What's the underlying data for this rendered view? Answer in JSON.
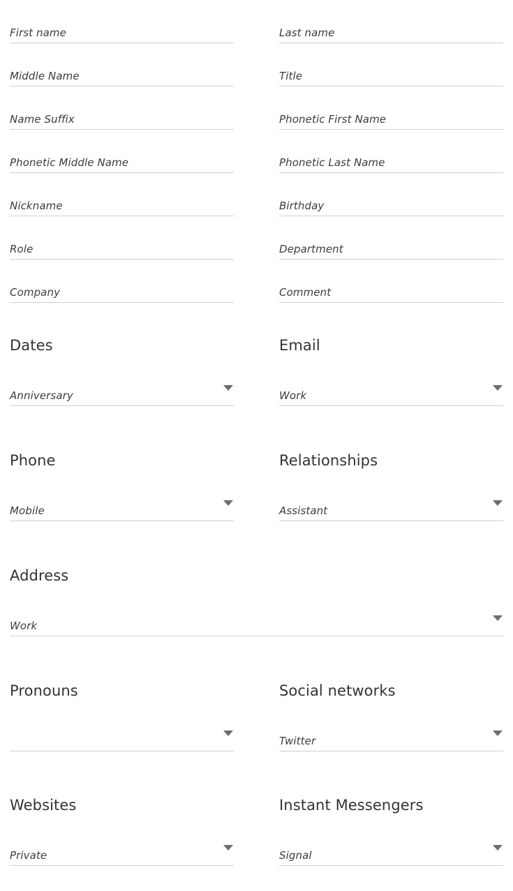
{
  "form": {
    "text_fields": [
      {
        "left": {
          "placeholder": "First name"
        },
        "right": {
          "placeholder": "Last name"
        }
      },
      {
        "left": {
          "placeholder": "Middle Name"
        },
        "right": {
          "placeholder": "Title"
        }
      },
      {
        "left": {
          "placeholder": "Name Suffix"
        },
        "right": {
          "placeholder": "Phonetic First Name"
        }
      },
      {
        "left": {
          "placeholder": "Phonetic Middle Name"
        },
        "right": {
          "placeholder": "Phonetic Last Name"
        }
      },
      {
        "left": {
          "placeholder": "Nickname"
        },
        "right": {
          "placeholder": "Birthday"
        }
      },
      {
        "left": {
          "placeholder": "Role"
        },
        "right": {
          "placeholder": "Department"
        }
      },
      {
        "left": {
          "placeholder": "Company"
        },
        "right": {
          "placeholder": "Comment"
        }
      }
    ],
    "sections": [
      {
        "title": "Dates",
        "select": {
          "value": "Anniversary",
          "icon": "chevron-down-icon"
        }
      },
      {
        "title": "Email",
        "select": {
          "value": "Work",
          "icon": "chevron-down-icon"
        }
      },
      {
        "title": "Phone",
        "select": {
          "value": "Mobile",
          "icon": "chevron-down-icon"
        }
      },
      {
        "title": "Relationships",
        "select": {
          "value": "Assistant",
          "icon": "chevron-down-icon"
        }
      },
      {
        "title": "Address",
        "select": {
          "value": "Work",
          "icon": "chevron-down-icon"
        }
      },
      {
        "title": "Pronouns",
        "select": {
          "value": "",
          "icon": "chevron-down-icon"
        }
      },
      {
        "title": "Social networks",
        "select": {
          "value": "Twitter",
          "icon": "chevron-down-icon"
        }
      },
      {
        "title": "Websites",
        "select": {
          "value": "Private",
          "icon": "chevron-down-icon"
        }
      },
      {
        "title": "Instant Messengers",
        "select": {
          "value": "Signal",
          "icon": "chevron-down-icon"
        }
      }
    ]
  },
  "colors": {
    "background": "#ffffff",
    "text": "#3c3c3c",
    "heading": "#333333",
    "underline": "#cfcfcf",
    "caret": "#6d6d6d"
  }
}
